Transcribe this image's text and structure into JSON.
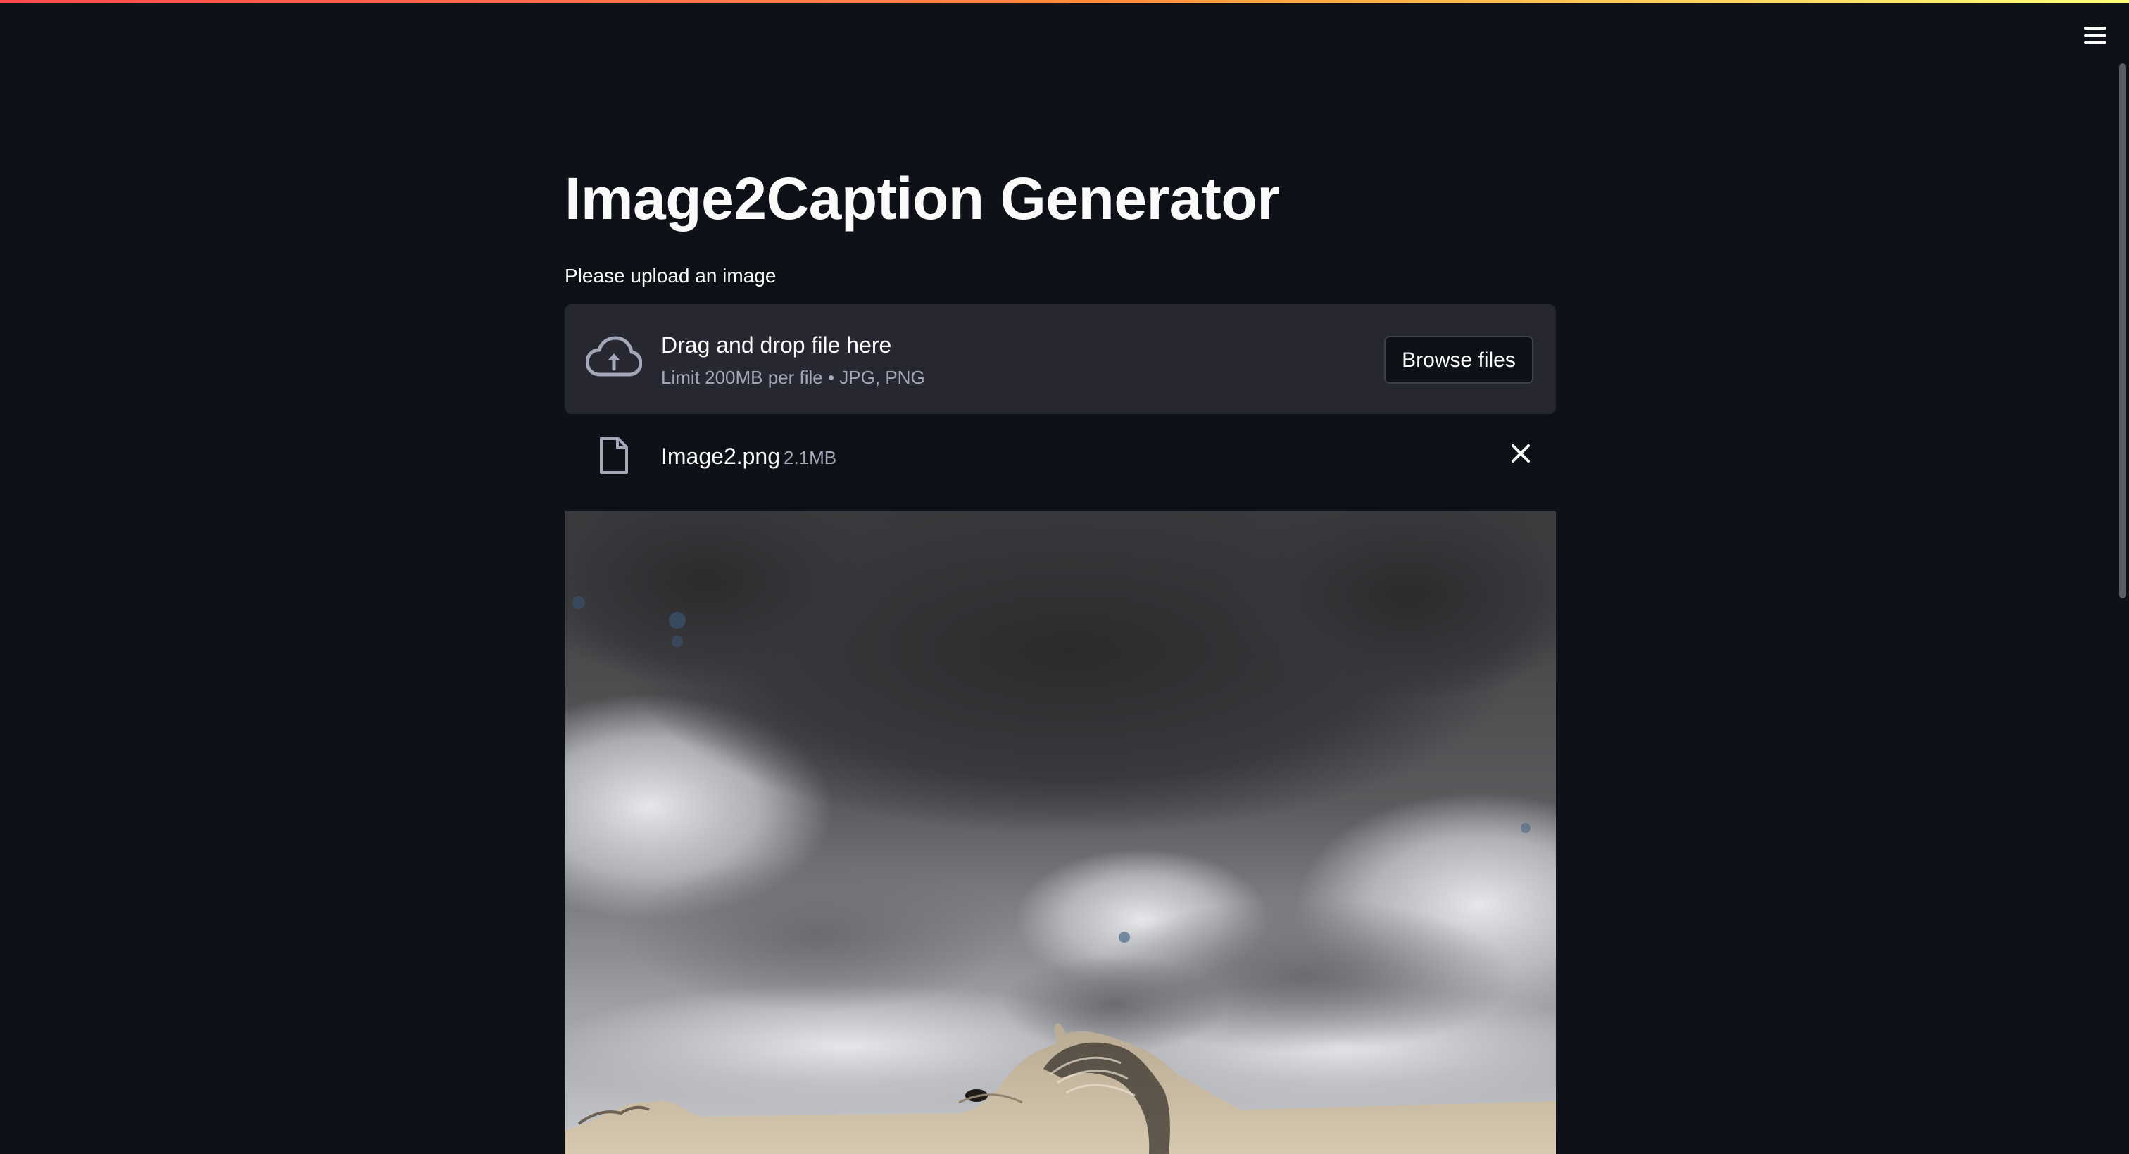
{
  "app": {
    "title": "Image2Caption Generator"
  },
  "uploader": {
    "label": "Please upload an image",
    "drop_title": "Drag and drop file here",
    "drop_subtitle": "Limit 200MB per file • JPG, PNG",
    "browse_label": "Browse files",
    "upload_icon": "cloud-upload-icon"
  },
  "uploaded_file": {
    "name": "Image2.png",
    "size": "2.1MB",
    "file_icon": "file-icon",
    "remove_icon": "close-icon"
  },
  "header": {
    "menu_icon": "hamburger-menu-icon"
  },
  "colors": {
    "background": "#0e1117",
    "dropzone": "#262730",
    "text": "#fafafa",
    "muted_text": "#a3a8b8",
    "accent_gradient_start": "#ff4b4b",
    "accent_gradient_end": "#fffd80"
  }
}
